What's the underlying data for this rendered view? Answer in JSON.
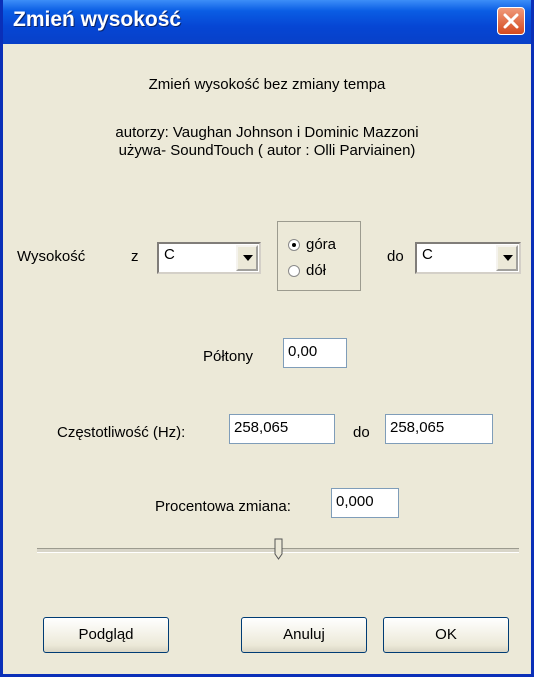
{
  "window": {
    "title": "Zmień wysokość"
  },
  "header": {
    "description": "Zmień wysokość bez zmiany tempa",
    "authors": "autorzy: Vaughan Johnson i Dominic Mazzoni",
    "uses": "używa- SoundTouch ( autor : Olli Parviainen)"
  },
  "pitch": {
    "label": "Wysokość",
    "from_label": "z",
    "from_value": "C",
    "direction_options": [
      "góra",
      "dół"
    ],
    "direction_selected": "góra",
    "to_label": "do",
    "to_value": "C"
  },
  "semitones": {
    "label": "Półtony",
    "value": "0,00"
  },
  "frequency": {
    "label": "Częstotliwość (Hz):",
    "from_value": "258,065",
    "to_label": "do",
    "to_value": "258,065"
  },
  "percent": {
    "label": "Procentowa zmiana:",
    "value": "0,000",
    "slider_position": 0.5
  },
  "buttons": {
    "preview": "Podgląd",
    "cancel": "Anuluj",
    "ok": "OK"
  },
  "colors": {
    "titlebar": "#0646d4",
    "dialog_bg": "#ece9d8",
    "close_button": "#d4491f"
  },
  "icons": [
    "close-icon",
    "dropdown-arrow-icon",
    "slider-thumb-icon"
  ]
}
